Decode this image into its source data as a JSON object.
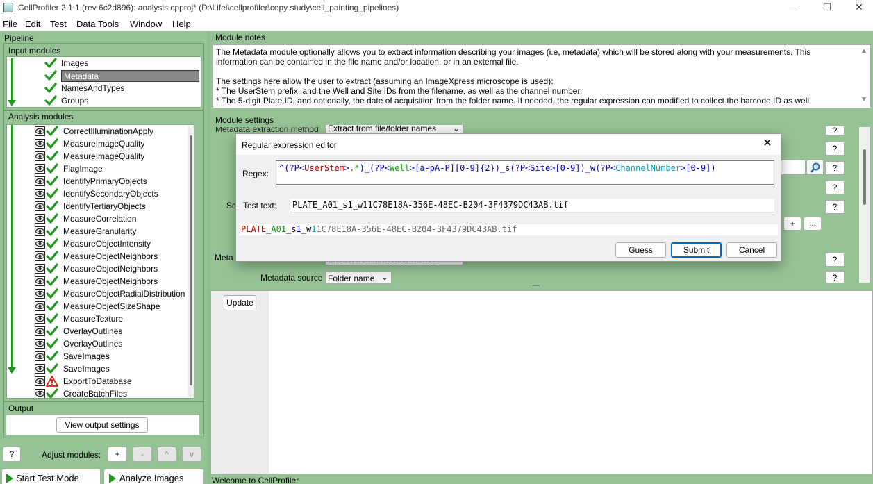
{
  "window": {
    "title": "CellProfiler 2.1.1 (rev 6c2d896): analysis.cpproj* (D:\\Lifei\\cellprofiler\\copy study\\cell_painting_pipelines)",
    "minimize": "—",
    "maximize": "☐",
    "close": "✕"
  },
  "menu": [
    "File",
    "Edit",
    "Test",
    "Data Tools",
    "Window",
    "Help"
  ],
  "pipeline": {
    "label": "Pipeline",
    "input_label": "Input modules",
    "input_modules": [
      "Images",
      "Metadata",
      "NamesAndTypes",
      "Groups"
    ],
    "selected_input": "Metadata",
    "analysis_label": "Analysis modules",
    "analysis_modules": [
      {
        "name": "CorrectIlluminationApply",
        "status": "ok"
      },
      {
        "name": "MeasureImageQuality",
        "status": "ok"
      },
      {
        "name": "MeasureImageQuality",
        "status": "ok"
      },
      {
        "name": "FlagImage",
        "status": "ok"
      },
      {
        "name": "IdentifyPrimaryObjects",
        "status": "ok"
      },
      {
        "name": "IdentifySecondaryObjects",
        "status": "ok"
      },
      {
        "name": "IdentifyTertiaryObjects",
        "status": "ok"
      },
      {
        "name": "MeasureCorrelation",
        "status": "ok"
      },
      {
        "name": "MeasureGranularity",
        "status": "ok"
      },
      {
        "name": "MeasureObjectIntensity",
        "status": "ok"
      },
      {
        "name": "MeasureObjectNeighbors",
        "status": "ok"
      },
      {
        "name": "MeasureObjectNeighbors",
        "status": "ok"
      },
      {
        "name": "MeasureObjectNeighbors",
        "status": "ok"
      },
      {
        "name": "MeasureObjectRadialDistribution",
        "status": "ok"
      },
      {
        "name": "MeasureObjectSizeShape",
        "status": "ok"
      },
      {
        "name": "MeasureTexture",
        "status": "ok"
      },
      {
        "name": "OverlayOutlines",
        "status": "ok"
      },
      {
        "name": "OverlayOutlines",
        "status": "ok"
      },
      {
        "name": "SaveImages",
        "status": "ok"
      },
      {
        "name": "SaveImages",
        "status": "ok"
      },
      {
        "name": "ExportToDatabase",
        "status": "warning"
      },
      {
        "name": "CreateBatchFiles",
        "status": "ok"
      }
    ]
  },
  "output": {
    "label": "Output",
    "view_button": "View output settings"
  },
  "adjust": {
    "help": "?",
    "label": "Adjust modules:",
    "add": "+",
    "remove": "-",
    "up": "^",
    "down": "v"
  },
  "bottom_buttons": {
    "test_mode": "Start Test Mode",
    "analyze": "Analyze Images"
  },
  "module_notes": {
    "label": "Module notes",
    "paragraph1": "The Metadata module optionally allows you to extract information describing your images (i.e, metadata) which will be stored along with your measurements. This information can be contained in the file name and/or location, or in an external file.",
    "paragraph2": "The settings here allow the user to extract (assuming an ImageXpress microscope is used):",
    "bullet1": "* The UserStem prefix, and the Well and Site IDs from the filename, as well as the channel number.",
    "bullet2": "* The 5-digit Plate ID, and optionally, the date of acquisition from the folder name. If needed, the regular expression can modified to collect the barcode ID as well."
  },
  "module_settings": {
    "label": "Module settings",
    "extraction_method_label": "Metadata extraction method",
    "extraction_method_value": "Extract from file/folder names",
    "partial_label_1": "Se",
    "partial_label_2": "Meta",
    "extraction_method_value_2": "Extract from file/folder names",
    "source_label": "Metadata source",
    "source_value": "Folder name",
    "help": "?",
    "add": "+",
    "more": "...",
    "update_button": "Update",
    "grip": "......"
  },
  "status": {
    "text": "Welcome to CellProfiler"
  },
  "dialog": {
    "title": "Regular expression editor",
    "close": "✕",
    "regex_label": "Regex:",
    "regex_tokens": [
      {
        "t": "^(?P<",
        "c": "#0000c0"
      },
      {
        "t": "UserStem",
        "c": "#c00000"
      },
      {
        "t": ">",
        "c": "#0000c0"
      },
      {
        "t": ".*",
        "c": "#00a000"
      },
      {
        "t": ")_(?P<",
        "c": "#0000c0"
      },
      {
        "t": "Well",
        "c": "#00b000"
      },
      {
        "t": ">[a-pA-P][0-9]{2}",
        "c": "#0000c0"
      },
      {
        "t": ")_s(?P<",
        "c": "#0000c0"
      },
      {
        "t": "Site",
        "c": "#0000c0"
      },
      {
        "t": ">[0-9])_w(?P<",
        "c": "#0000c0"
      },
      {
        "t": "ChannelNumber",
        "c": "#00a0c0"
      },
      {
        "t": ">[0-9])",
        "c": "#0000c0"
      }
    ],
    "test_label": "Test text:",
    "test_value": "PLATE_A01_s1_w11C78E18A-356E-48EC-B204-3F4379DC43AB.tif",
    "result_tokens": [
      {
        "t": "PLATE",
        "c": "#c00000"
      },
      {
        "t": "_",
        "c": "#000000"
      },
      {
        "t": "A01",
        "c": "#00a000"
      },
      {
        "t": "_s",
        "c": "#000000"
      },
      {
        "t": "1",
        "c": "#0000c0"
      },
      {
        "t": "_w",
        "c": "#000000"
      },
      {
        "t": "1",
        "c": "#00a0c0"
      },
      {
        "t": "1C78E18A-356E-48EC-B204-3F4379DC43AB.tif",
        "c": "#666666"
      }
    ],
    "guess": "Guess",
    "submit": "Submit",
    "cancel": "Cancel"
  }
}
